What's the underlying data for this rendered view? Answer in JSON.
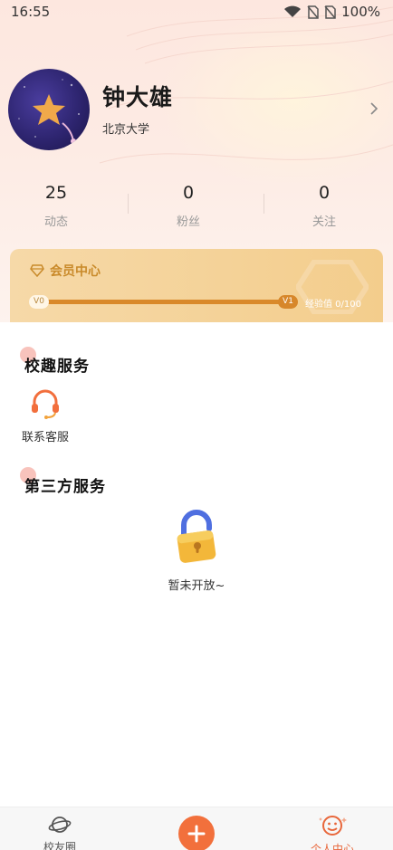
{
  "status_bar": {
    "time": "16:55",
    "battery": "100%"
  },
  "profile": {
    "name": "钟大雄",
    "school": "北京大学"
  },
  "stats": [
    {
      "value": "25",
      "label": "动态"
    },
    {
      "value": "0",
      "label": "粉丝"
    },
    {
      "value": "0",
      "label": "关注"
    }
  ],
  "membership": {
    "title": "会员中心",
    "current_level": "V0",
    "next_level": "V1",
    "progress": 0,
    "exp_text": "经验值 0/100"
  },
  "sections": {
    "campus_services": {
      "title": "校趣服务",
      "items": [
        {
          "label": "联系客服",
          "icon": "headset-icon"
        }
      ]
    },
    "third_party": {
      "title": "第三方服务",
      "empty_text": "暂未开放~",
      "icon": "lock-icon"
    }
  },
  "tab_bar": {
    "tabs": [
      {
        "label": "校友圈",
        "icon": "planet-icon",
        "active": false
      },
      {
        "label": "个人中心",
        "icon": "smiley-icon",
        "active": true
      }
    ],
    "fab_icon": "plus-icon"
  },
  "colors": {
    "accent": "#f2703c",
    "member_gold": "#d7872a",
    "header_bg": "#fde7df"
  }
}
